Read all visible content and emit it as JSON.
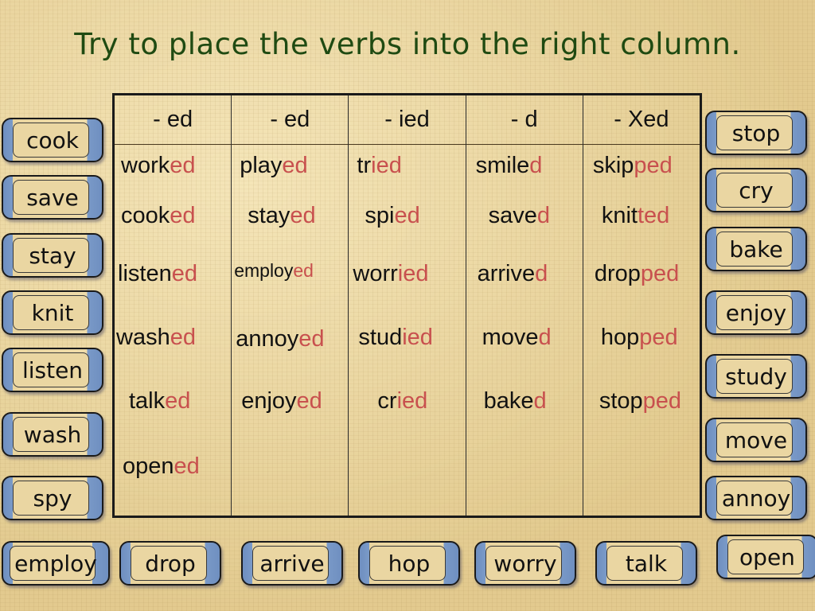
{
  "title": "Try to place the verbs into the right column.",
  "colors": {
    "title": "#1f4a12",
    "suffix": "#c8504e",
    "tile_edge": "#6f8fc0",
    "background": "#e8d29a"
  },
  "table": {
    "columns": [
      {
        "header": "- ed",
        "words": [
          {
            "stem": "work",
            "suffix": "ed"
          },
          {
            "stem": "cook",
            "suffix": "ed"
          },
          {
            "stem": "listen",
            "suffix": "ed"
          },
          {
            "stem": "wash",
            "suffix": "ed"
          },
          {
            "stem": "talk",
            "suffix": "ed"
          },
          {
            "stem": "open",
            "suffix": "ed"
          }
        ]
      },
      {
        "header": "- ed",
        "words": [
          {
            "stem": "play",
            "suffix": "ed"
          },
          {
            "stem": "stay",
            "suffix": "ed"
          },
          {
            "stem": "employ",
            "suffix": "ed"
          },
          {
            "stem": "annoy",
            "suffix": "ed"
          },
          {
            "stem": "enjoy",
            "suffix": "ed"
          }
        ]
      },
      {
        "header": "- ied",
        "words": [
          {
            "stem": "tr",
            "suffix": "ied"
          },
          {
            "stem": "spi",
            "suffix": "ed"
          },
          {
            "stem": "worr",
            "suffix": "ied"
          },
          {
            "stem": "stud",
            "suffix": "ied"
          },
          {
            "stem": "cr",
            "suffix": "ied"
          }
        ]
      },
      {
        "header": "- d",
        "words": [
          {
            "stem": "smile",
            "suffix": "d"
          },
          {
            "stem": "save",
            "suffix": "d"
          },
          {
            "stem": "arrive",
            "suffix": "d"
          },
          {
            "stem": "move",
            "suffix": "d"
          },
          {
            "stem": "bake",
            "suffix": "d"
          }
        ]
      },
      {
        "header": "- Xed",
        "words": [
          {
            "stem": "skip",
            "suffix": "ped"
          },
          {
            "stem": "knit",
            "suffix": "ted"
          },
          {
            "stem": "drop",
            "suffix": "ped"
          },
          {
            "stem": "hop",
            "suffix": "ped"
          },
          {
            "stem": "stop",
            "suffix": "ped"
          }
        ]
      }
    ]
  },
  "tiles": {
    "left": [
      "cook",
      "save",
      "stay",
      "knit",
      "listen",
      "wash",
      "spy"
    ],
    "right": [
      "stop",
      "cry",
      "bake",
      "enjoy",
      "study",
      "move",
      "annoy"
    ],
    "bottom": [
      "employ",
      "drop",
      "arrive",
      "hop",
      "worry",
      "talk",
      "open"
    ]
  }
}
